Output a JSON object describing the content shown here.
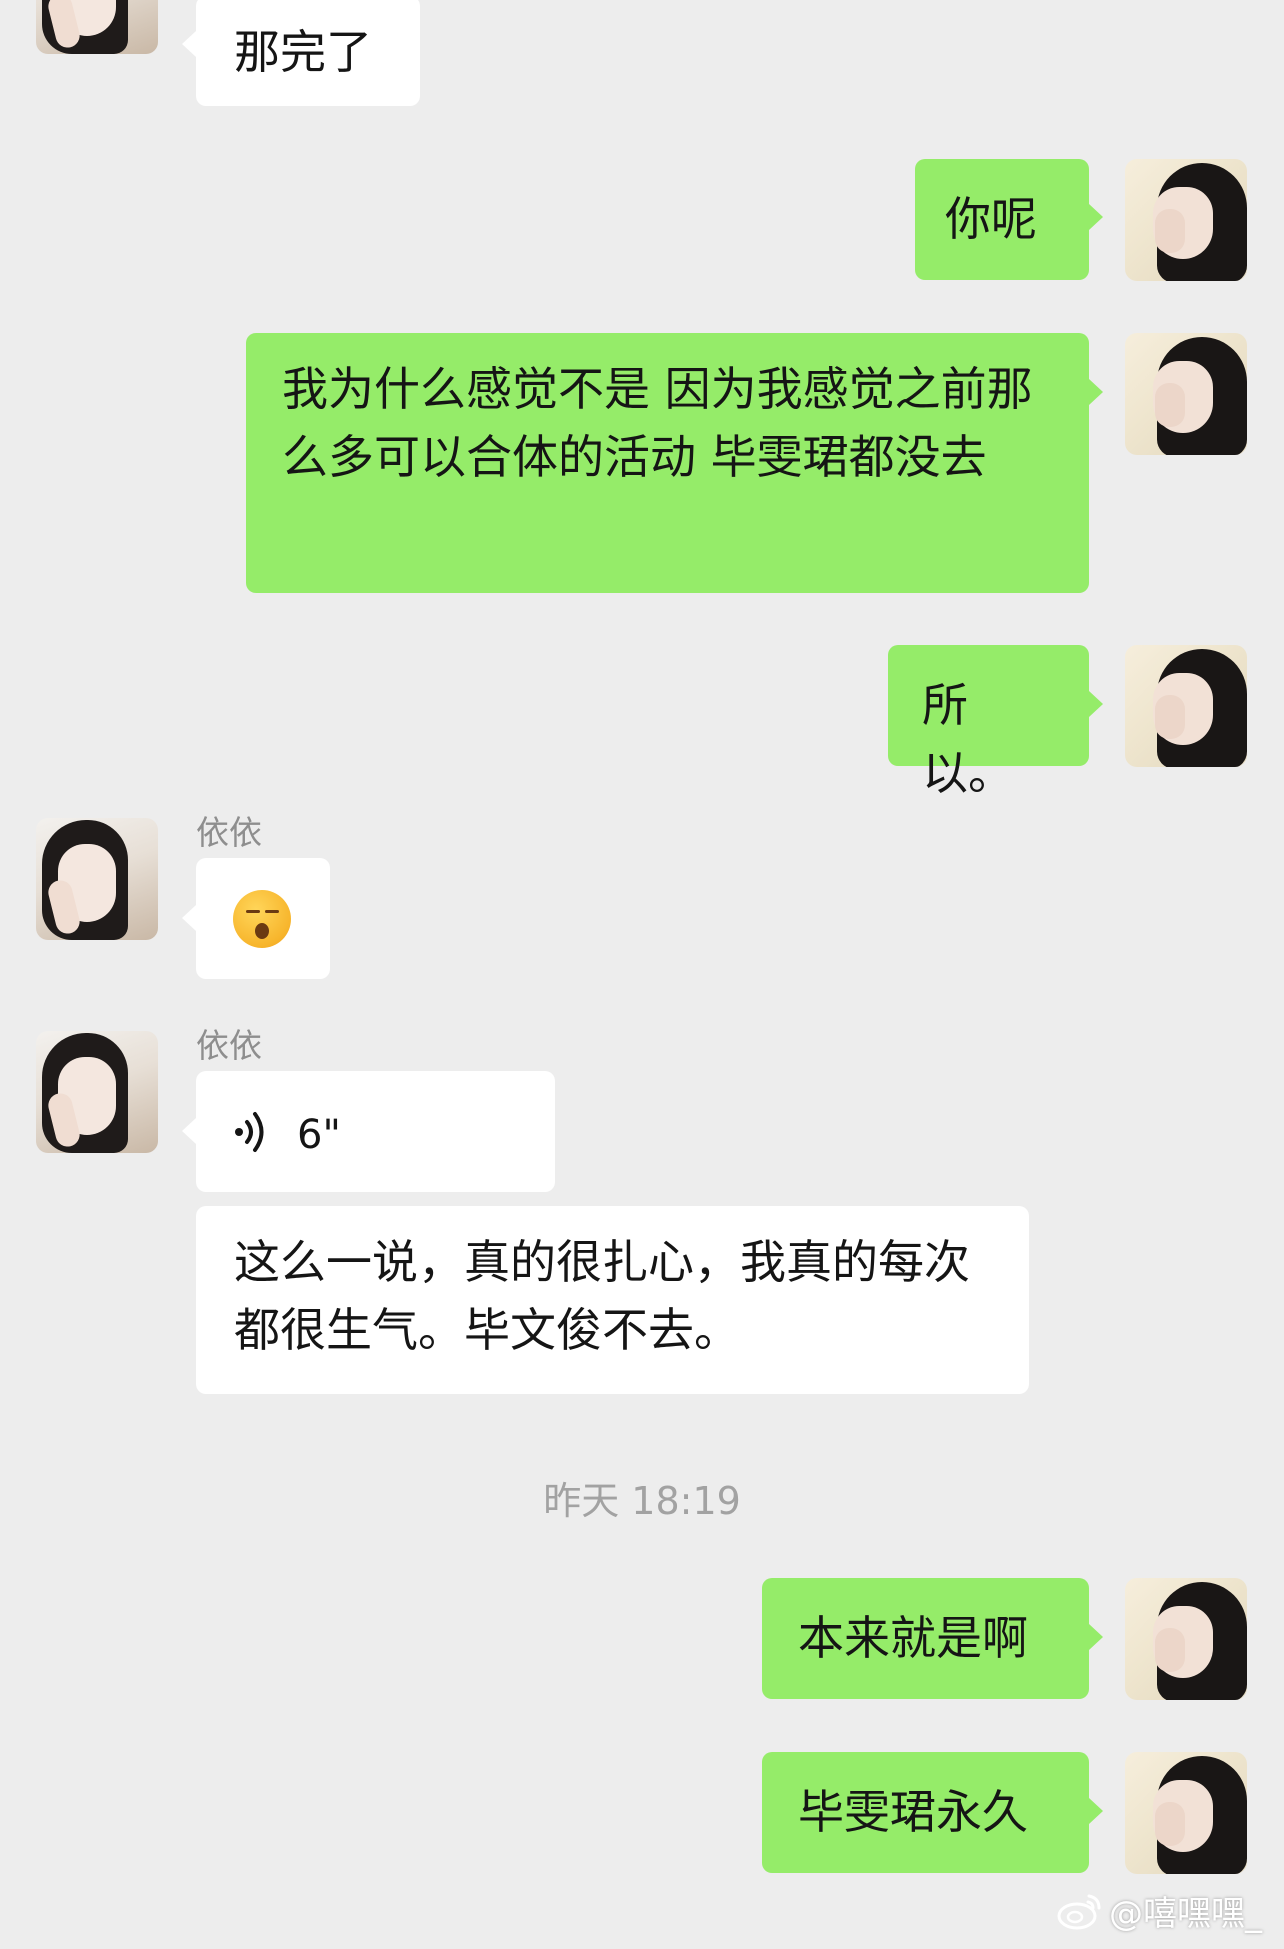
{
  "chat": {
    "messages": [
      {
        "side": "left",
        "type": "text",
        "text": "那完了"
      },
      {
        "side": "right",
        "type": "text",
        "text": "你呢"
      },
      {
        "side": "right",
        "type": "text",
        "text": "我为什么感觉不是 因为我感觉之前那么多可以合体的活动 毕雯珺都没去"
      },
      {
        "side": "right",
        "type": "text",
        "text": "所以。"
      },
      {
        "side": "left",
        "sender": "依依",
        "type": "emoji",
        "emoji_name": "kiss-emoji"
      },
      {
        "side": "left",
        "sender": "依依",
        "type": "voice",
        "duration": "6\""
      },
      {
        "side": "left",
        "type": "text",
        "text": "这么一说，真的很扎心，我真的每次都很生气。毕文俊不去。"
      },
      {
        "side": "right",
        "type": "text",
        "text": "本来就是啊"
      },
      {
        "side": "right",
        "type": "text",
        "text": "毕雯珺永久"
      }
    ],
    "timestamp": "昨天 18:19"
  },
  "watermark": {
    "text": "@嘻嘿嘿_",
    "icon": "weibo-icon"
  },
  "colors": {
    "background": "#ededed",
    "bubble_right": "#95ec69",
    "bubble_left": "#ffffff"
  }
}
